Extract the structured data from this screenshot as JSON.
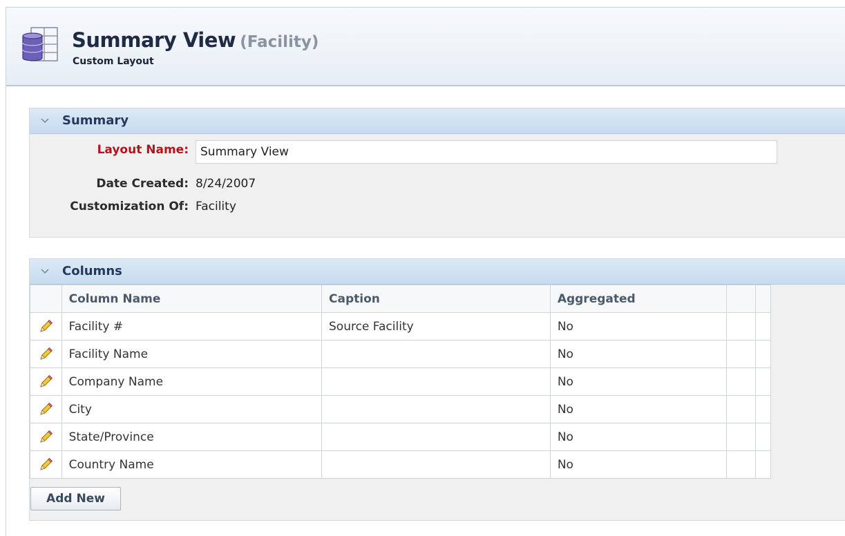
{
  "header": {
    "title": "Summary View",
    "context": "(Facility)",
    "subtitle": "Custom Layout",
    "icon": "database-table-icon"
  },
  "summary": {
    "section_title": "Summary",
    "layout_name_label": "Layout Name:",
    "layout_name_value": "Summary View",
    "date_created_label": "Date Created:",
    "date_created_value": "8/24/2007",
    "customization_of_label": "Customization Of:",
    "customization_of_value": "Facility"
  },
  "columns": {
    "section_title": "Columns",
    "headers": [
      "Column Name",
      "Caption",
      "Aggregated"
    ],
    "rows": [
      {
        "name": "Facility #",
        "caption": "Source Facility",
        "aggregated": "No"
      },
      {
        "name": "Facility Name",
        "caption": "",
        "aggregated": "No"
      },
      {
        "name": "Company Name",
        "caption": "",
        "aggregated": "No"
      },
      {
        "name": "City",
        "caption": "",
        "aggregated": "No"
      },
      {
        "name": "State/Province",
        "caption": "",
        "aggregated": "No"
      },
      {
        "name": "Country Name",
        "caption": "",
        "aggregated": "No"
      }
    ],
    "add_new_label": "Add New"
  },
  "colors": {
    "required_label": "#b3141b",
    "section_header": "#c6dbef",
    "section_title": "#233a5a"
  }
}
